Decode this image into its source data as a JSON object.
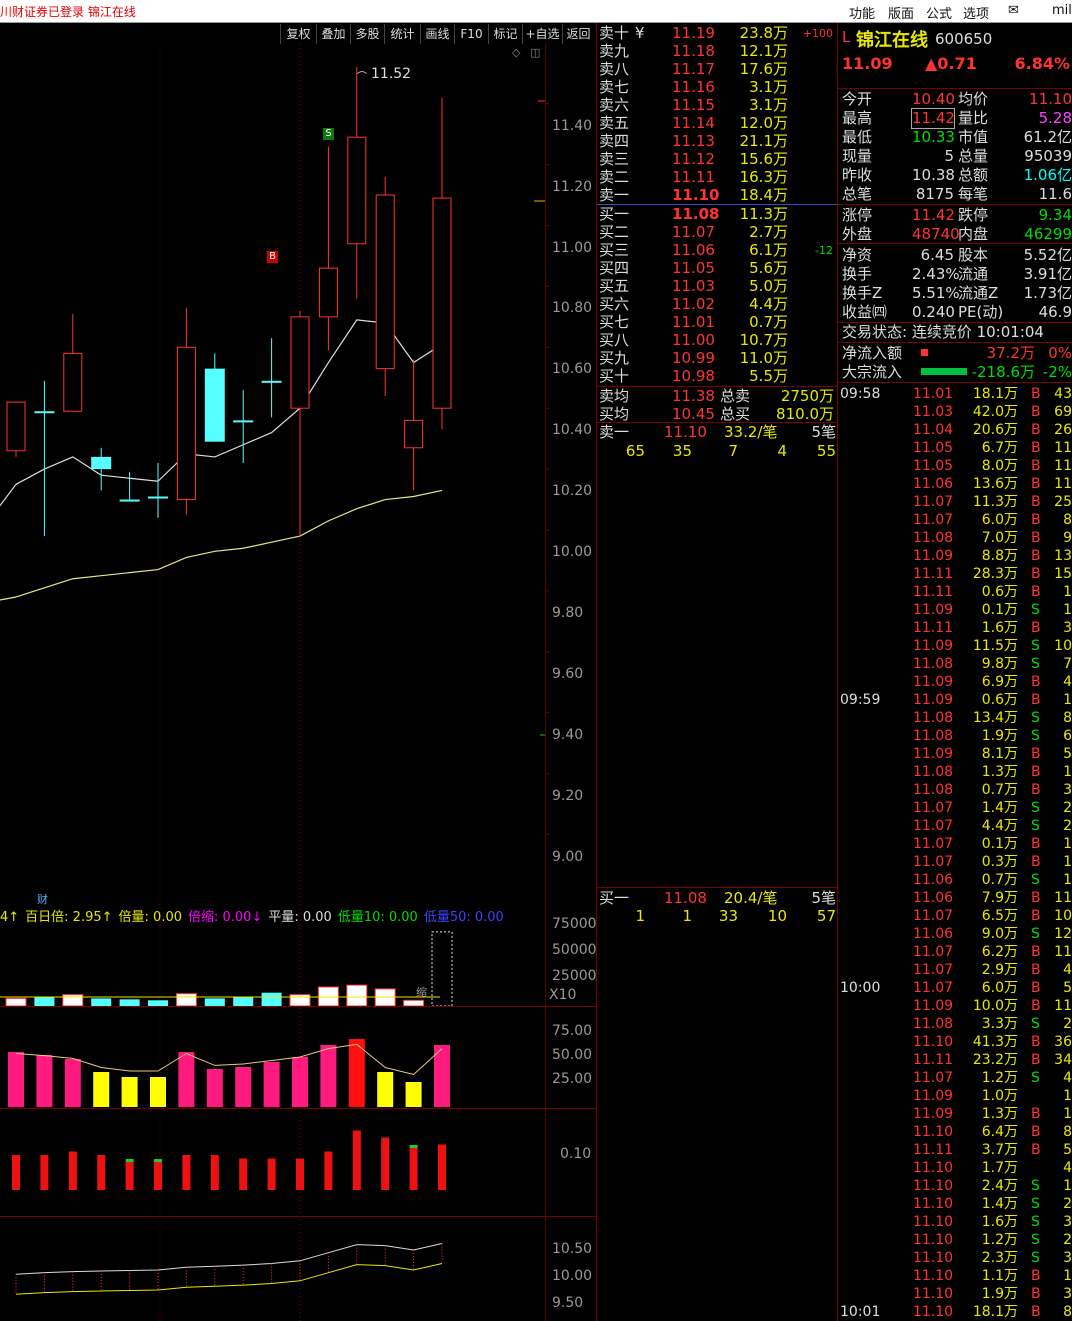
{
  "topbar": {
    "left": "川财证券已登录  锦江在线",
    "menus": [
      "功能",
      "版面",
      "公式",
      "选项",
      "✉",
      "mil"
    ]
  },
  "toolbar": [
    "复权",
    "叠加",
    "多股",
    "统计",
    "画线",
    "F10",
    "标记",
    "+自选",
    "返回"
  ],
  "chart": {
    "max_label": "11.52",
    "price_axis": [
      "11.40",
      "11.20",
      "11.00",
      "10.80",
      "10.60",
      "10.40",
      "10.20",
      "10.00",
      "9.80",
      "9.60",
      "9.40",
      "9.20",
      "9.00"
    ],
    "vol_axis": [
      "75000",
      "50000",
      "25000",
      "X10"
    ],
    "ind2_axis": [
      "75.00",
      "50.00",
      "25.00"
    ],
    "ind3_axis": [
      "0.10"
    ],
    "ind4_axis": [
      "10.50",
      "10.00",
      "9.50"
    ],
    "markers": {
      "b": "B",
      "s": "S",
      "cai": "财",
      "suo": "缩"
    },
    "vol_legend": [
      {
        "t": "4↑",
        "c": "#e8e800"
      },
      {
        "t": "百日倍: 2.95↑",
        "c": "#e8e800"
      },
      {
        "t": "倍量: 0.00",
        "c": "#e8e800"
      },
      {
        "t": "倍缩: 0.00↓",
        "c": "#ff00ff"
      },
      {
        "t": "平量: 0.00",
        "c": "#ddd"
      },
      {
        "t": "低量10: 0.00",
        "c": "#00dd00"
      },
      {
        "t": "低量50: 0.00",
        "c": "#4040ff"
      }
    ],
    "candles": [
      {
        "o": 10.26,
        "c": 10.42,
        "h": 10.42,
        "l": 10.24
      },
      {
        "o": 10.39,
        "c": 10.39,
        "h": 10.49,
        "l": 9.98
      },
      {
        "o": 10.39,
        "c": 10.58,
        "h": 10.71,
        "l": 10.39
      },
      {
        "o": 10.24,
        "c": 10.2,
        "h": 10.27,
        "l": 10.13
      },
      {
        "o": 10.1,
        "c": 10.1,
        "h": 10.19,
        "l": 10.1
      },
      {
        "o": 10.11,
        "c": 10.11,
        "h": 10.22,
        "l": 10.04
      },
      {
        "o": 10.1,
        "c": 10.6,
        "h": 10.73,
        "l": 10.05
      },
      {
        "o": 10.53,
        "c": 10.29,
        "h": 10.58,
        "l": 10.29
      },
      {
        "o": 10.36,
        "c": 10.36,
        "h": 10.46,
        "l": 10.22
      },
      {
        "o": 10.49,
        "c": 10.49,
        "h": 10.63,
        "l": 10.37
      },
      {
        "o": 10.4,
        "c": 10.7,
        "h": 10.72,
        "l": 9.98
      },
      {
        "o": 10.7,
        "c": 10.86,
        "h": 11.26,
        "l": 10.59
      },
      {
        "o": 10.94,
        "c": 11.29,
        "h": 11.52,
        "l": 10.76
      },
      {
        "o": 10.53,
        "c": 11.1,
        "h": 11.16,
        "l": 10.44
      },
      {
        "o": 10.27,
        "c": 10.36,
        "h": 10.56,
        "l": 10.13
      },
      {
        "o": 10.4,
        "c": 11.09,
        "h": 11.42,
        "l": 10.33
      }
    ],
    "ma5": [
      10.15,
      10.2,
      10.24,
      10.18,
      10.17,
      10.16,
      10.25,
      10.24,
      10.28,
      10.32,
      10.4,
      10.55,
      10.69,
      10.68,
      10.55,
      10.61
    ],
    "ma20": [
      9.78,
      9.81,
      9.84,
      9.85,
      9.86,
      9.87,
      9.91,
      9.93,
      9.94,
      9.96,
      9.98,
      10.03,
      10.07,
      10.1,
      10.11,
      10.13
    ],
    "volumes": [
      8,
      9,
      12,
      8,
      7,
      6,
      13,
      8,
      9,
      14,
      12,
      20,
      22,
      18,
      6,
      78
    ],
    "ind2": [
      55,
      52,
      48,
      35,
      30,
      30,
      55,
      38,
      40,
      45,
      50,
      62,
      68,
      35,
      25,
      62
    ],
    "ind3": [
      0.1,
      0.1,
      0.11,
      0.1,
      0.08,
      0.08,
      0.1,
      0.1,
      0.09,
      0.09,
      0.09,
      0.11,
      0.17,
      0.15,
      0.12,
      0.13
    ],
    "ind4": [
      10.05,
      10.08,
      10.1,
      10.11,
      10.12,
      10.13,
      10.18,
      10.2,
      10.22,
      10.25,
      10.3,
      10.45,
      10.6,
      10.58,
      10.5,
      10.62
    ]
  },
  "quote": {
    "sell": [
      {
        "lbl": "卖十",
        "p": "11.19",
        "v": "23.8万",
        "ex": "+100",
        "mk": "¥"
      },
      {
        "lbl": "卖九",
        "p": "11.18",
        "v": "12.1万"
      },
      {
        "lbl": "卖八",
        "p": "11.17",
        "v": "17.6万"
      },
      {
        "lbl": "卖七",
        "p": "11.16",
        "v": "3.1万"
      },
      {
        "lbl": "卖六",
        "p": "11.15",
        "v": "3.1万"
      },
      {
        "lbl": "卖五",
        "p": "11.14",
        "v": "12.0万"
      },
      {
        "lbl": "卖四",
        "p": "11.13",
        "v": "21.1万"
      },
      {
        "lbl": "卖三",
        "p": "11.12",
        "v": "15.6万"
      },
      {
        "lbl": "卖二",
        "p": "11.11",
        "v": "16.3万"
      },
      {
        "lbl": "卖一",
        "p": "11.10",
        "v": "18.4万"
      }
    ],
    "buy": [
      {
        "lbl": "买一",
        "p": "11.08",
        "v": "11.3万"
      },
      {
        "lbl": "买二",
        "p": "11.07",
        "v": "2.7万"
      },
      {
        "lbl": "买三",
        "p": "11.06",
        "v": "6.1万",
        "ex": "-12"
      },
      {
        "lbl": "买四",
        "p": "11.05",
        "v": "5.6万"
      },
      {
        "lbl": "买五",
        "p": "11.03",
        "v": "5.0万"
      },
      {
        "lbl": "买六",
        "p": "11.02",
        "v": "4.4万"
      },
      {
        "lbl": "买七",
        "p": "11.01",
        "v": "0.7万"
      },
      {
        "lbl": "买八",
        "p": "11.00",
        "v": "10.7万"
      },
      {
        "lbl": "买九",
        "p": "10.99",
        "v": "11.0万"
      },
      {
        "lbl": "买十",
        "p": "10.98",
        "v": "5.5万"
      }
    ],
    "avg_sell": {
      "lbl": "卖均",
      "p": "11.38",
      "tl": "总卖",
      "tv": "2750万"
    },
    "avg_buy": {
      "lbl": "买均",
      "p": "10.45",
      "tl": "总买",
      "tv": "810.0万"
    },
    "sell1_row": {
      "lbl": "卖一",
      "p": "11.10",
      "v": "33.2/笔",
      "n": "5笔"
    },
    "sell1_q": [
      "65",
      "35",
      "7",
      "4",
      "55"
    ],
    "buy1_row": {
      "lbl": "买一",
      "p": "11.08",
      "v": "20.4/笔",
      "n": "5笔"
    },
    "buy1_q": [
      "1",
      "1",
      "33",
      "10",
      "57"
    ]
  },
  "stock": {
    "flag": "L",
    "name": "锦江在线",
    "code": "600650",
    "price": "11.09",
    "change": "▲0.71",
    "pct": "6.84%",
    "info": [
      [
        "今开",
        "10.40",
        "均价",
        "11.10"
      ],
      [
        "最高",
        "11.42",
        "量比",
        "5.28"
      ],
      [
        "最低",
        "10.33",
        "市值",
        "61.2亿"
      ],
      [
        "现量",
        "5",
        "总量",
        "95039"
      ],
      [
        "昨收",
        "10.38",
        "总额",
        "1.06亿"
      ],
      [
        "总笔",
        "8175",
        "每笔",
        "11.6"
      ],
      [
        "涨停",
        "11.42",
        "跌停",
        "9.34"
      ],
      [
        "外盘",
        "48740",
        "内盘",
        "46299"
      ],
      [
        "净资",
        "6.45",
        "股本",
        "5.52亿"
      ],
      [
        "换手",
        "2.43%",
        "流通",
        "3.91亿"
      ],
      [
        "换手Z",
        "5.51%",
        "流通Z",
        "1.73亿"
      ],
      [
        "收益㈣",
        "0.240",
        "PE(动)",
        "46.9"
      ]
    ],
    "status": "交易状态: 连续竞价 10:01:04",
    "net_in": {
      "lbl": "净流入额",
      "v": "37.2万",
      "p": "0%"
    },
    "block": {
      "lbl": "大宗流入",
      "v": "-218.6万",
      "p": "-2%"
    }
  },
  "ticks": [
    {
      "t": "09:58",
      "p": "11.01",
      "v": "18.1万",
      "d": "B",
      "n": "43"
    },
    {
      "p": "11.03",
      "v": "42.0万",
      "d": "B",
      "n": "69"
    },
    {
      "p": "11.04",
      "v": "20.6万",
      "d": "B",
      "n": "26"
    },
    {
      "p": "11.05",
      "v": "6.7万",
      "d": "B",
      "n": "11"
    },
    {
      "p": "11.05",
      "v": "8.0万",
      "d": "B",
      "n": "11"
    },
    {
      "p": "11.06",
      "v": "13.6万",
      "d": "B",
      "n": "11"
    },
    {
      "p": "11.07",
      "v": "11.3万",
      "d": "B",
      "n": "25"
    },
    {
      "p": "11.07",
      "v": "6.0万",
      "d": "B",
      "n": "8"
    },
    {
      "p": "11.08",
      "v": "7.0万",
      "d": "B",
      "n": "9"
    },
    {
      "p": "11.09",
      "v": "8.8万",
      "d": "B",
      "n": "13"
    },
    {
      "p": "11.11",
      "v": "28.3万",
      "d": "B",
      "n": "15"
    },
    {
      "p": "11.11",
      "v": "0.6万",
      "d": "B",
      "n": "1"
    },
    {
      "p": "11.09",
      "v": "0.1万",
      "d": "S",
      "n": "1"
    },
    {
      "p": "11.11",
      "v": "1.6万",
      "d": "B",
      "n": "3"
    },
    {
      "p": "11.09",
      "v": "11.5万",
      "d": "S",
      "n": "10"
    },
    {
      "p": "11.08",
      "v": "9.8万",
      "d": "S",
      "n": "7"
    },
    {
      "p": "11.09",
      "v": "6.9万",
      "d": "B",
      "n": "4"
    },
    {
      "t": "09:59",
      "p": "11.09",
      "v": "0.6万",
      "d": "B",
      "n": "1"
    },
    {
      "p": "11.08",
      "v": "13.4万",
      "d": "S",
      "n": "8"
    },
    {
      "p": "11.08",
      "v": "1.9万",
      "d": "S",
      "n": "6"
    },
    {
      "p": "11.09",
      "v": "8.1万",
      "d": "B",
      "n": "5"
    },
    {
      "p": "11.08",
      "v": "1.3万",
      "d": "B",
      "n": "1"
    },
    {
      "p": "11.08",
      "v": "0.7万",
      "d": "B",
      "n": "3"
    },
    {
      "p": "11.07",
      "v": "1.4万",
      "d": "S",
      "n": "2"
    },
    {
      "p": "11.07",
      "v": "4.4万",
      "d": "S",
      "n": "2"
    },
    {
      "p": "11.07",
      "v": "0.1万",
      "d": "B",
      "n": "1"
    },
    {
      "p": "11.07",
      "v": "0.3万",
      "d": "B",
      "n": "1"
    },
    {
      "p": "11.06",
      "v": "0.7万",
      "d": "S",
      "n": "1"
    },
    {
      "p": "11.06",
      "v": "7.9万",
      "d": "B",
      "n": "11"
    },
    {
      "p": "11.07",
      "v": "6.5万",
      "d": "B",
      "n": "10"
    },
    {
      "p": "11.06",
      "v": "9.0万",
      "d": "S",
      "n": "12"
    },
    {
      "p": "11.07",
      "v": "6.2万",
      "d": "B",
      "n": "11"
    },
    {
      "p": "11.07",
      "v": "2.9万",
      "d": "B",
      "n": "4"
    },
    {
      "t": "10:00",
      "p": "11.07",
      "v": "6.0万",
      "d": "B",
      "n": "5"
    },
    {
      "p": "11.09",
      "v": "10.0万",
      "d": "B",
      "n": "11"
    },
    {
      "p": "11.08",
      "v": "3.3万",
      "d": "S",
      "n": "2"
    },
    {
      "p": "11.10",
      "v": "41.3万",
      "d": "B",
      "n": "36"
    },
    {
      "p": "11.11",
      "v": "23.2万",
      "d": "B",
      "n": "34"
    },
    {
      "p": "11.07",
      "v": "1.2万",
      "d": "S",
      "n": "4"
    },
    {
      "p": "11.09",
      "v": "1.0万",
      "d": "",
      "n": "1"
    },
    {
      "p": "11.09",
      "v": "1.3万",
      "d": "B",
      "n": "1"
    },
    {
      "p": "11.10",
      "v": "6.4万",
      "d": "B",
      "n": "8"
    },
    {
      "p": "11.11",
      "v": "3.7万",
      "d": "B",
      "n": "5"
    },
    {
      "p": "11.10",
      "v": "1.7万",
      "d": "",
      "n": "4"
    },
    {
      "p": "11.10",
      "v": "2.4万",
      "d": "S",
      "n": "1"
    },
    {
      "p": "11.10",
      "v": "1.4万",
      "d": "S",
      "n": "2"
    },
    {
      "p": "11.10",
      "v": "1.6万",
      "d": "S",
      "n": "3"
    },
    {
      "p": "11.10",
      "v": "1.2万",
      "d": "S",
      "n": "2"
    },
    {
      "p": "11.10",
      "v": "2.3万",
      "d": "S",
      "n": "3"
    },
    {
      "p": "11.10",
      "v": "1.1万",
      "d": "B",
      "n": "1"
    },
    {
      "p": "11.10",
      "v": "1.9万",
      "d": "B",
      "n": "3"
    },
    {
      "t": "10:01",
      "p": "11.10",
      "v": "18.1万",
      "d": "B",
      "n": "8"
    }
  ]
}
